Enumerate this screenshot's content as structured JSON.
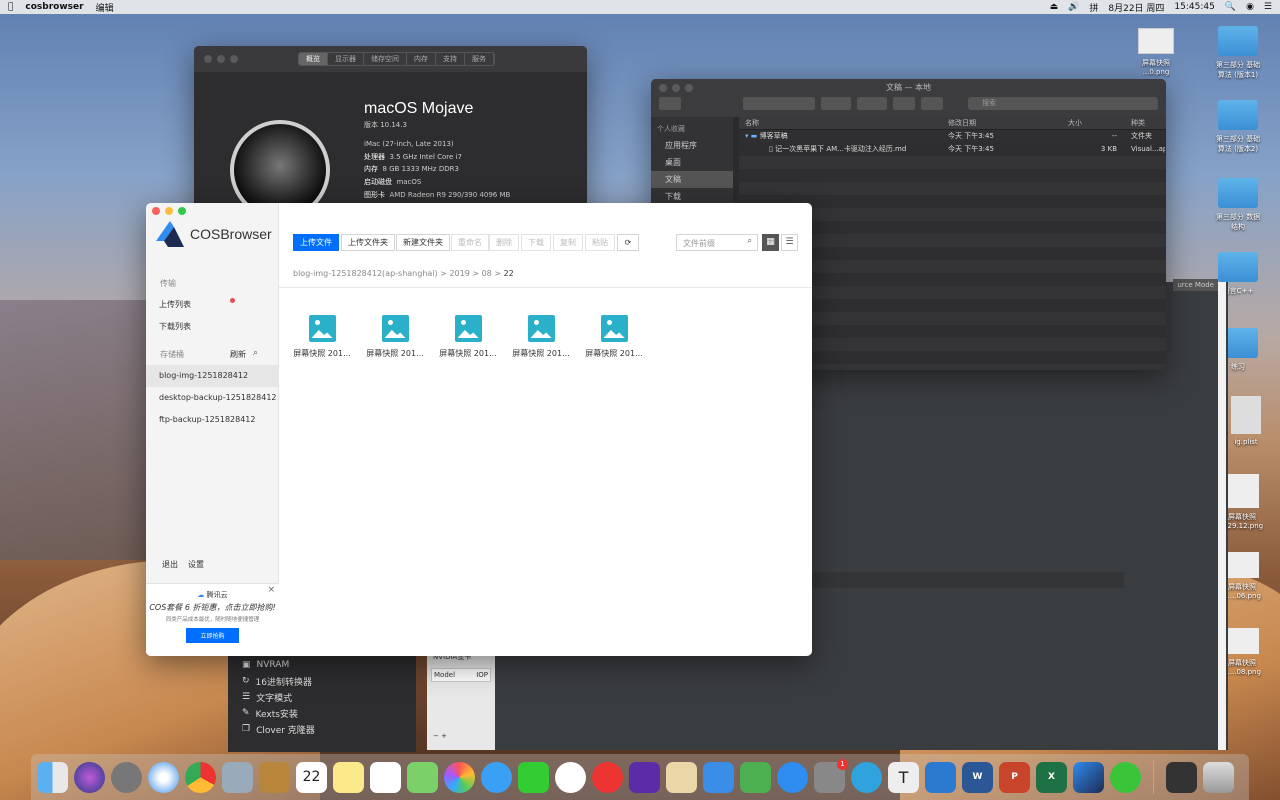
{
  "menubar": {
    "app": "cosbrowser",
    "menu": "编辑",
    "date": "8月22日 周四",
    "time": "15:45:45"
  },
  "about": {
    "tabs": [
      "概览",
      "显示器",
      "储存空间",
      "内存",
      "支持",
      "服务"
    ],
    "title": "macOS Mojave",
    "version": "版本 10.14.3",
    "model": "iMac (27-inch, Late 2013)",
    "cpu_label": "处理器",
    "cpu": "3.5 GHz Intel Core i7",
    "mem_label": "内存",
    "mem": "8 GB 1333 MHz DDR3",
    "disk_label": "启动磁盘",
    "disk": "macOS",
    "gpu_label": "图形卡",
    "gpu": "AMD Radeon R9 290/390 4096 MB"
  },
  "finder": {
    "title": "文稿 — 本地",
    "search_placeholder": "搜索",
    "sidebar": {
      "header": "个人收藏",
      "items": [
        "应用程序",
        "桌面",
        "文稿",
        "下载"
      ]
    },
    "columns": [
      "名称",
      "修改日期",
      "大小",
      "种类"
    ],
    "rows": [
      {
        "name": "博客草稿",
        "date": "今天 下午3:45",
        "size": "--",
        "kind": "文件夹"
      },
      {
        "name": "记一次黑苹果下 AM...卡驱动注入经历.md",
        "date": "今天 下午3:45",
        "size": "3 KB",
        "kind": "Visual...ap"
      }
    ]
  },
  "editor": {
    "tab": "urce Mode"
  },
  "clover": {
    "items": [
      "NVRAM",
      "16进制转换器",
      "文字模式",
      "Kexts安装",
      "Clover 克隆器"
    ]
  },
  "nvidia": {
    "title": "NVIDIA显卡",
    "col1": "Model",
    "col2": "IOP"
  },
  "cos": {
    "brand": "COSBrowser",
    "transfer_header": "传输",
    "upload_list": "上传列表",
    "download_list": "下载列表",
    "bucket_header": "存储桶",
    "refresh": "刷新",
    "buckets": [
      "blog-img-1251828412",
      "desktop-backup-1251828412",
      "ftp-backup-1251828412"
    ],
    "logout": "退出",
    "settings": "设置",
    "ad": {
      "brand": "腾讯云",
      "headline": "COS套餐 6 折钜惠，点击立即抢购!",
      "sub": "同类产品成本最优，随时随地便捷管理",
      "cta": "立即抢购"
    },
    "toolbar": {
      "upload_file": "上传文件",
      "upload_folder": "上传文件夹",
      "new_folder": "新建文件夹",
      "rename": "重命名",
      "delete": "删除",
      "download": "下载",
      "copy": "复制",
      "paste": "粘贴",
      "search_placeholder": "文件前缀"
    },
    "breadcrumb": [
      "blog-img-1251828412(ap-shanghai)",
      "2019",
      "08",
      "22"
    ],
    "files": [
      "屏幕快照 201...",
      "屏幕快照 201...",
      "屏幕快照 201...",
      "屏幕快照 201...",
      "屏幕快照 201..."
    ]
  },
  "desktop": {
    "icons": [
      {
        "label": "屏幕快照\n...0.png"
      },
      {
        "label": "第三部分 基础算法\n(版本1)"
      },
      {
        "label": "...4.png"
      },
      {
        "label": "第三部分 基础算法\n(版本2)"
      },
      {
        "label": "第三部分 数据结构"
      },
      {
        "label": "语言C++"
      },
      {
        "label": "练习"
      },
      {
        "label": "ig.plist"
      },
      {
        "label": "屏幕快照\n...29.12.png"
      },
      {
        "label": "屏幕快照\n8....06.png"
      },
      {
        "label": "屏幕快照\n8....08.png"
      }
    ]
  },
  "dock": {
    "badge": "1",
    "calendar_day": "22"
  }
}
